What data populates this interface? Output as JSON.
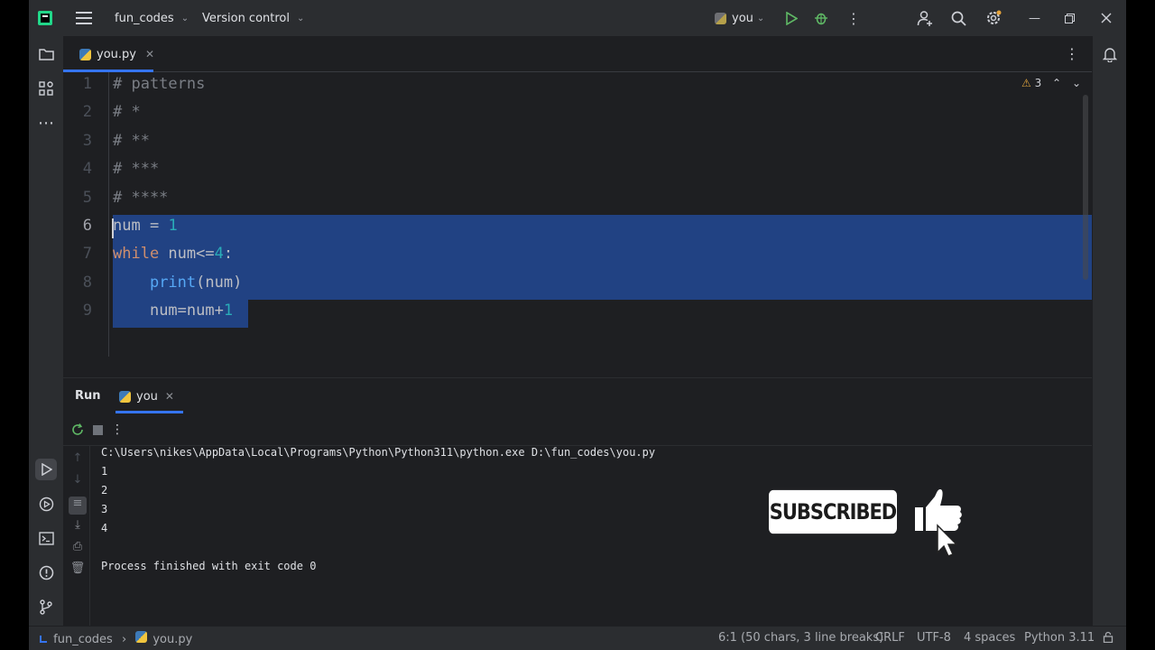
{
  "titlebar": {
    "project": "fun_codes",
    "vcs": "Version control",
    "run_config": "you"
  },
  "editor": {
    "tab_label": "you.py",
    "warnings": "3",
    "lines": [
      {
        "n": "1",
        "text": "# patterns"
      },
      {
        "n": "2",
        "text": "# *"
      },
      {
        "n": "3",
        "text": "# **"
      },
      {
        "n": "4",
        "text": "# ***"
      },
      {
        "n": "5",
        "text": "# ****"
      },
      {
        "n": "6"
      },
      {
        "n": "7"
      },
      {
        "n": "8"
      },
      {
        "n": "9"
      }
    ],
    "code": {
      "l6": {
        "ident": "num",
        "op": " = ",
        "num": "1"
      },
      "l7": {
        "kw": "while",
        "rest": " num<=",
        "num": "4",
        "colon": ":"
      },
      "l8": {
        "indent": "    ",
        "fn": "print",
        "args": "(num)"
      },
      "l9": {
        "indent": "    ",
        "expr": "num=num+",
        "num": "1"
      }
    }
  },
  "run": {
    "title": "Run",
    "tab_label": "you",
    "console": [
      "C:\\Users\\nikes\\AppData\\Local\\Programs\\Python\\Python311\\python.exe D:\\fun_codes\\you.py",
      "1",
      "2",
      "3",
      "4",
      "",
      "Process finished with exit code 0"
    ]
  },
  "overlay": {
    "subscribed": "SUBSCRIBED"
  },
  "statusbar": {
    "project": "fun_codes",
    "file": "you.py",
    "position": "6:1 (50 chars, 3 line breaks)",
    "line_sep": "CRLF",
    "encoding": "UTF-8",
    "indent": "4 spaces",
    "interpreter": "Python 3.11"
  },
  "colors": {
    "accent": "#3574f0",
    "selection": "#214283",
    "run_green": "#5fb865"
  }
}
